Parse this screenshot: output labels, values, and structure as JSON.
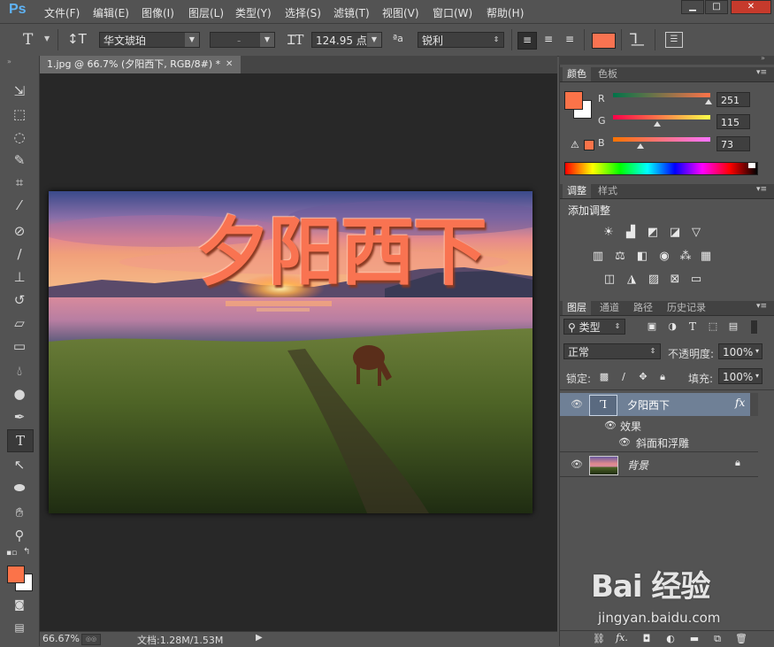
{
  "app": {
    "logo": "Ps"
  },
  "menu": [
    "文件(F)",
    "编辑(E)",
    "图像(I)",
    "图层(L)",
    "类型(Y)",
    "选择(S)",
    "滤镜(T)",
    "视图(V)",
    "窗口(W)",
    "帮助(H)"
  ],
  "options": {
    "font_family": "华文琥珀",
    "font_style": "-",
    "font_size": "124.95 点",
    "aa_label": "ªa",
    "aa_method": "锐利",
    "text_color": "#f97351"
  },
  "document": {
    "tab_title": "1.jpg @ 66.7% (夕阳西下, RGB/8#) *",
    "canvas_text": "夕阳西下",
    "zoom": "66.67%",
    "doc_size": "文档:1.28M/1.53M"
  },
  "color_panel": {
    "tabs": [
      "颜色",
      "色板"
    ],
    "r_label": "R",
    "g_label": "G",
    "b_label": "B",
    "r": 251,
    "g": 115,
    "b": 73,
    "foreground": "#fb7349",
    "background": "#ffffff"
  },
  "adjust_panel": {
    "tabs": [
      "调整",
      "样式"
    ],
    "title": "添加调整"
  },
  "layers_panel": {
    "tabs": [
      "图层",
      "通道",
      "路径",
      "历史记录"
    ],
    "filter_kind": "类型",
    "blend_mode": "正常",
    "opacity_label": "不透明度:",
    "opacity": "100%",
    "lock_label": "锁定:",
    "fill_label": "填充:",
    "fill": "100%",
    "layers": [
      {
        "name": "夕阳西下",
        "fx": "fx",
        "effects_label": "效果",
        "effect": "斜面和浮雕"
      },
      {
        "name": "背景"
      }
    ]
  },
  "watermark": {
    "brand": "Bai 经验",
    "url": "jingyan.baidu.com"
  }
}
